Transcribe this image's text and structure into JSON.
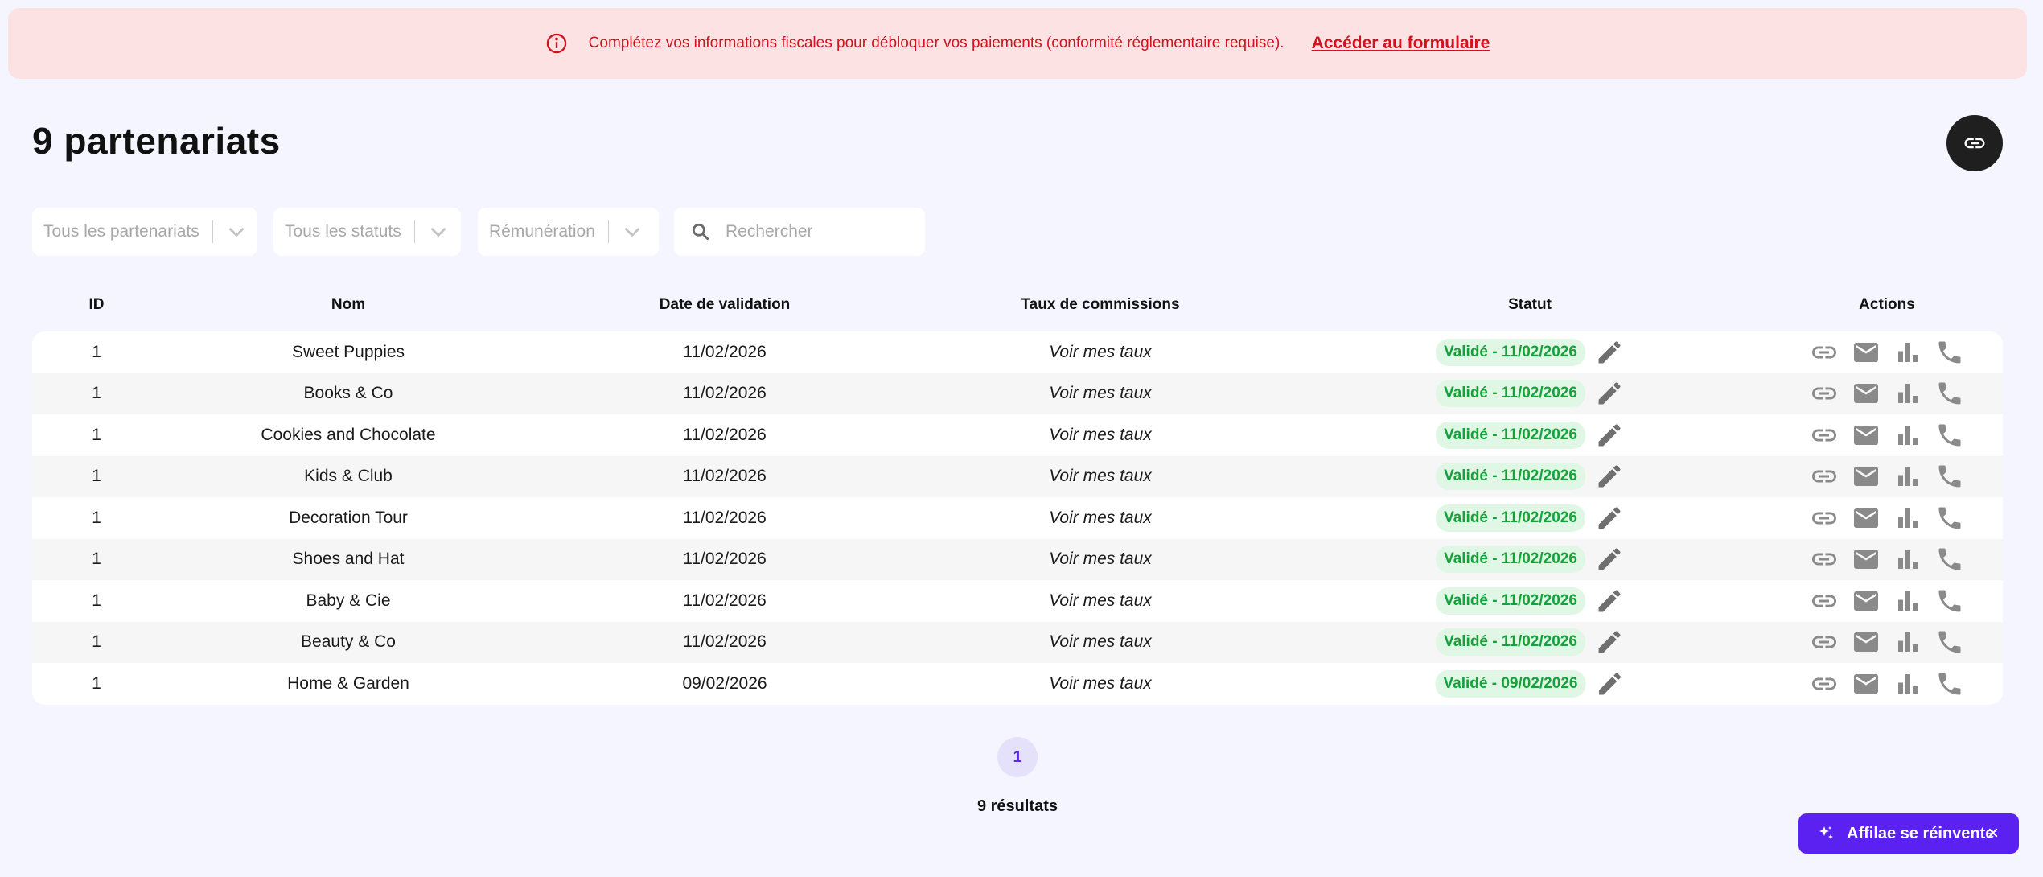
{
  "banner": {
    "icon": "info-circle-icon",
    "text": "Complétez vos informations fiscales pour débloquer vos paiements (conformité réglementaire requise).",
    "link_label": "Accéder au formulaire",
    "color": "#d4111e",
    "background": "#fde2e4"
  },
  "title": "9 partenariats",
  "filters": {
    "partnerships_placeholder": "Tous les partenariats",
    "statuses_placeholder": "Tous les statuts",
    "remuneration_placeholder": "Rémunération",
    "search_placeholder": "Rechercher"
  },
  "table": {
    "headers": {
      "id": "ID",
      "name": "Nom",
      "date": "Date de validation",
      "rate": "Taux de commissions",
      "status": "Statut",
      "actions": "Actions"
    },
    "rows": [
      {
        "id": "1",
        "name": "Sweet Puppies",
        "date": "11/02/2026",
        "rate": "Voir mes taux",
        "status": "Validé - 11/02/2026"
      },
      {
        "id": "1",
        "name": "Books & Co",
        "date": "11/02/2026",
        "rate": "Voir mes taux",
        "status": "Validé - 11/02/2026"
      },
      {
        "id": "1",
        "name": "Cookies and Chocolate",
        "date": "11/02/2026",
        "rate": "Voir mes taux",
        "status": "Validé - 11/02/2026"
      },
      {
        "id": "1",
        "name": "Kids & Club",
        "date": "11/02/2026",
        "rate": "Voir mes taux",
        "status": "Validé - 11/02/2026"
      },
      {
        "id": "1",
        "name": "Decoration Tour",
        "date": "11/02/2026",
        "rate": "Voir mes taux",
        "status": "Validé - 11/02/2026"
      },
      {
        "id": "1",
        "name": "Shoes and Hat",
        "date": "11/02/2026",
        "rate": "Voir mes taux",
        "status": "Validé - 11/02/2026"
      },
      {
        "id": "1",
        "name": "Baby & Cie",
        "date": "11/02/2026",
        "rate": "Voir mes taux",
        "status": "Validé - 11/02/2026"
      },
      {
        "id": "1",
        "name": "Beauty & Co",
        "date": "11/02/2026",
        "rate": "Voir mes taux",
        "status": "Validé - 11/02/2026"
      },
      {
        "id": "1",
        "name": "Home & Garden",
        "date": "09/02/2026",
        "rate": "Voir mes taux",
        "status": "Validé - 09/02/2026"
      }
    ],
    "action_icons": [
      "link-icon",
      "mail-icon",
      "bar-chart-icon",
      "phone-icon"
    ],
    "status_color": "#14a33a"
  },
  "pagination": {
    "current_page": "1",
    "results": "9 résultats"
  },
  "promo": {
    "icon": "sparkles-icon",
    "label": "Affilae se réinvente",
    "background": "#5b21f0"
  }
}
